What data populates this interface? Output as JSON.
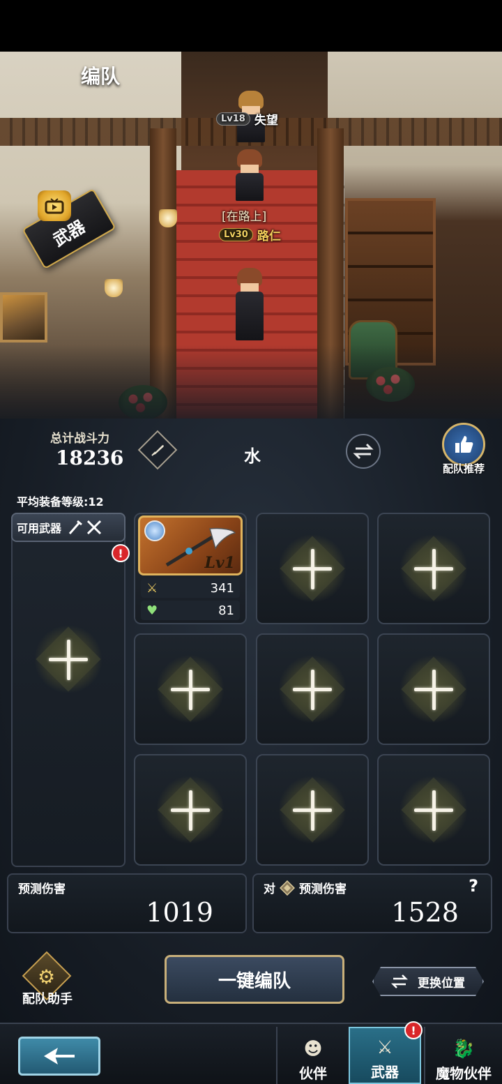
{
  "header": {
    "title": "编队"
  },
  "scene": {
    "banner_label": "武器",
    "characters": [
      {
        "level": "Lv18",
        "name": "失望",
        "status": ""
      },
      {
        "level": "Lv30",
        "name": "路仁",
        "status": "[在路上]"
      }
    ]
  },
  "team": {
    "power_label": "总计战斗力",
    "power_value": "18236",
    "team_name": "水",
    "recommend_label": "配队推荐",
    "avg_level_text": "平均装备等级:12"
  },
  "available": {
    "header_label": "可用武器",
    "alert": "!"
  },
  "equipped_weapon": {
    "level": "Lv1",
    "attack": "341",
    "hp": "81"
  },
  "damage": {
    "predicted_label": "预测伤害",
    "predicted_value": "1019",
    "versus_prefix": "对",
    "versus_label": "预测伤害",
    "versus_value": "1528",
    "help": "?"
  },
  "actions": {
    "assistant_label": "配队助手",
    "one_key_label": "一键编队",
    "change_position_label": "更换位置"
  },
  "nav": {
    "tabs": [
      {
        "label": "伙伴",
        "icon": "person-icon"
      },
      {
        "label": "武器",
        "icon": "crossed-swords-icon",
        "alert": "!"
      },
      {
        "label": "魔物伙伴",
        "icon": "dragon-icon"
      }
    ]
  },
  "colors": {
    "accent_gold": "#d0a84a",
    "active_tab": "#2a6f88",
    "alert_red": "#d9262a"
  }
}
